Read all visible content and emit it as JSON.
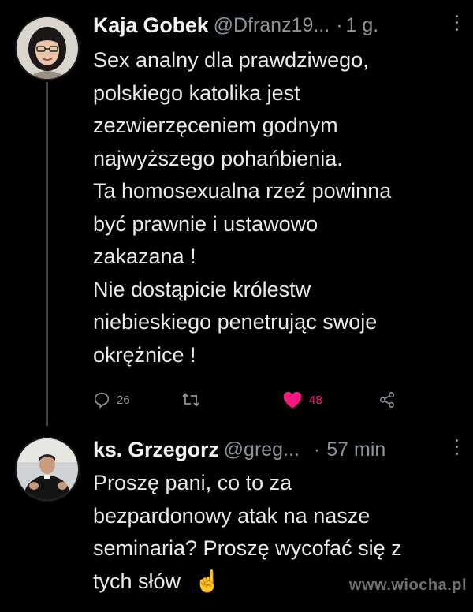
{
  "tweets": [
    {
      "name": "Kaja Gobek",
      "handle": "@Dfranz19...",
      "separator": "·",
      "time": "1 g.",
      "lines": [
        "Sex analny dla prawdziwego,",
        "polskiego katolika jest",
        "zezwierzęceniem godnym",
        "najwyższego pohańbienia.",
        "Ta homosexualna rzeź powinna",
        "być prawnie i ustawowo",
        "zakazana !",
        "Nie dostąpicie królestw",
        "niebieskiego penetrując swoje",
        "okrężnice !"
      ],
      "replies": "26",
      "retweets": "",
      "likes": "48",
      "liked": true
    },
    {
      "name": "ks. Grzegorz",
      "handle": "@greg...",
      "separator": "·",
      "time": "57 min",
      "lines": [
        "Proszę pani, co to za",
        "bezpardonowy atak na nasze",
        "seminaria? Proszę wycofać się z",
        "tych słów"
      ],
      "emoji": "☝"
    }
  ],
  "watermark": "www.wiocha.pl",
  "colors": {
    "background": "#000000",
    "text": "#e7e9ea",
    "muted": "#8b949b",
    "like": "#f91880"
  }
}
